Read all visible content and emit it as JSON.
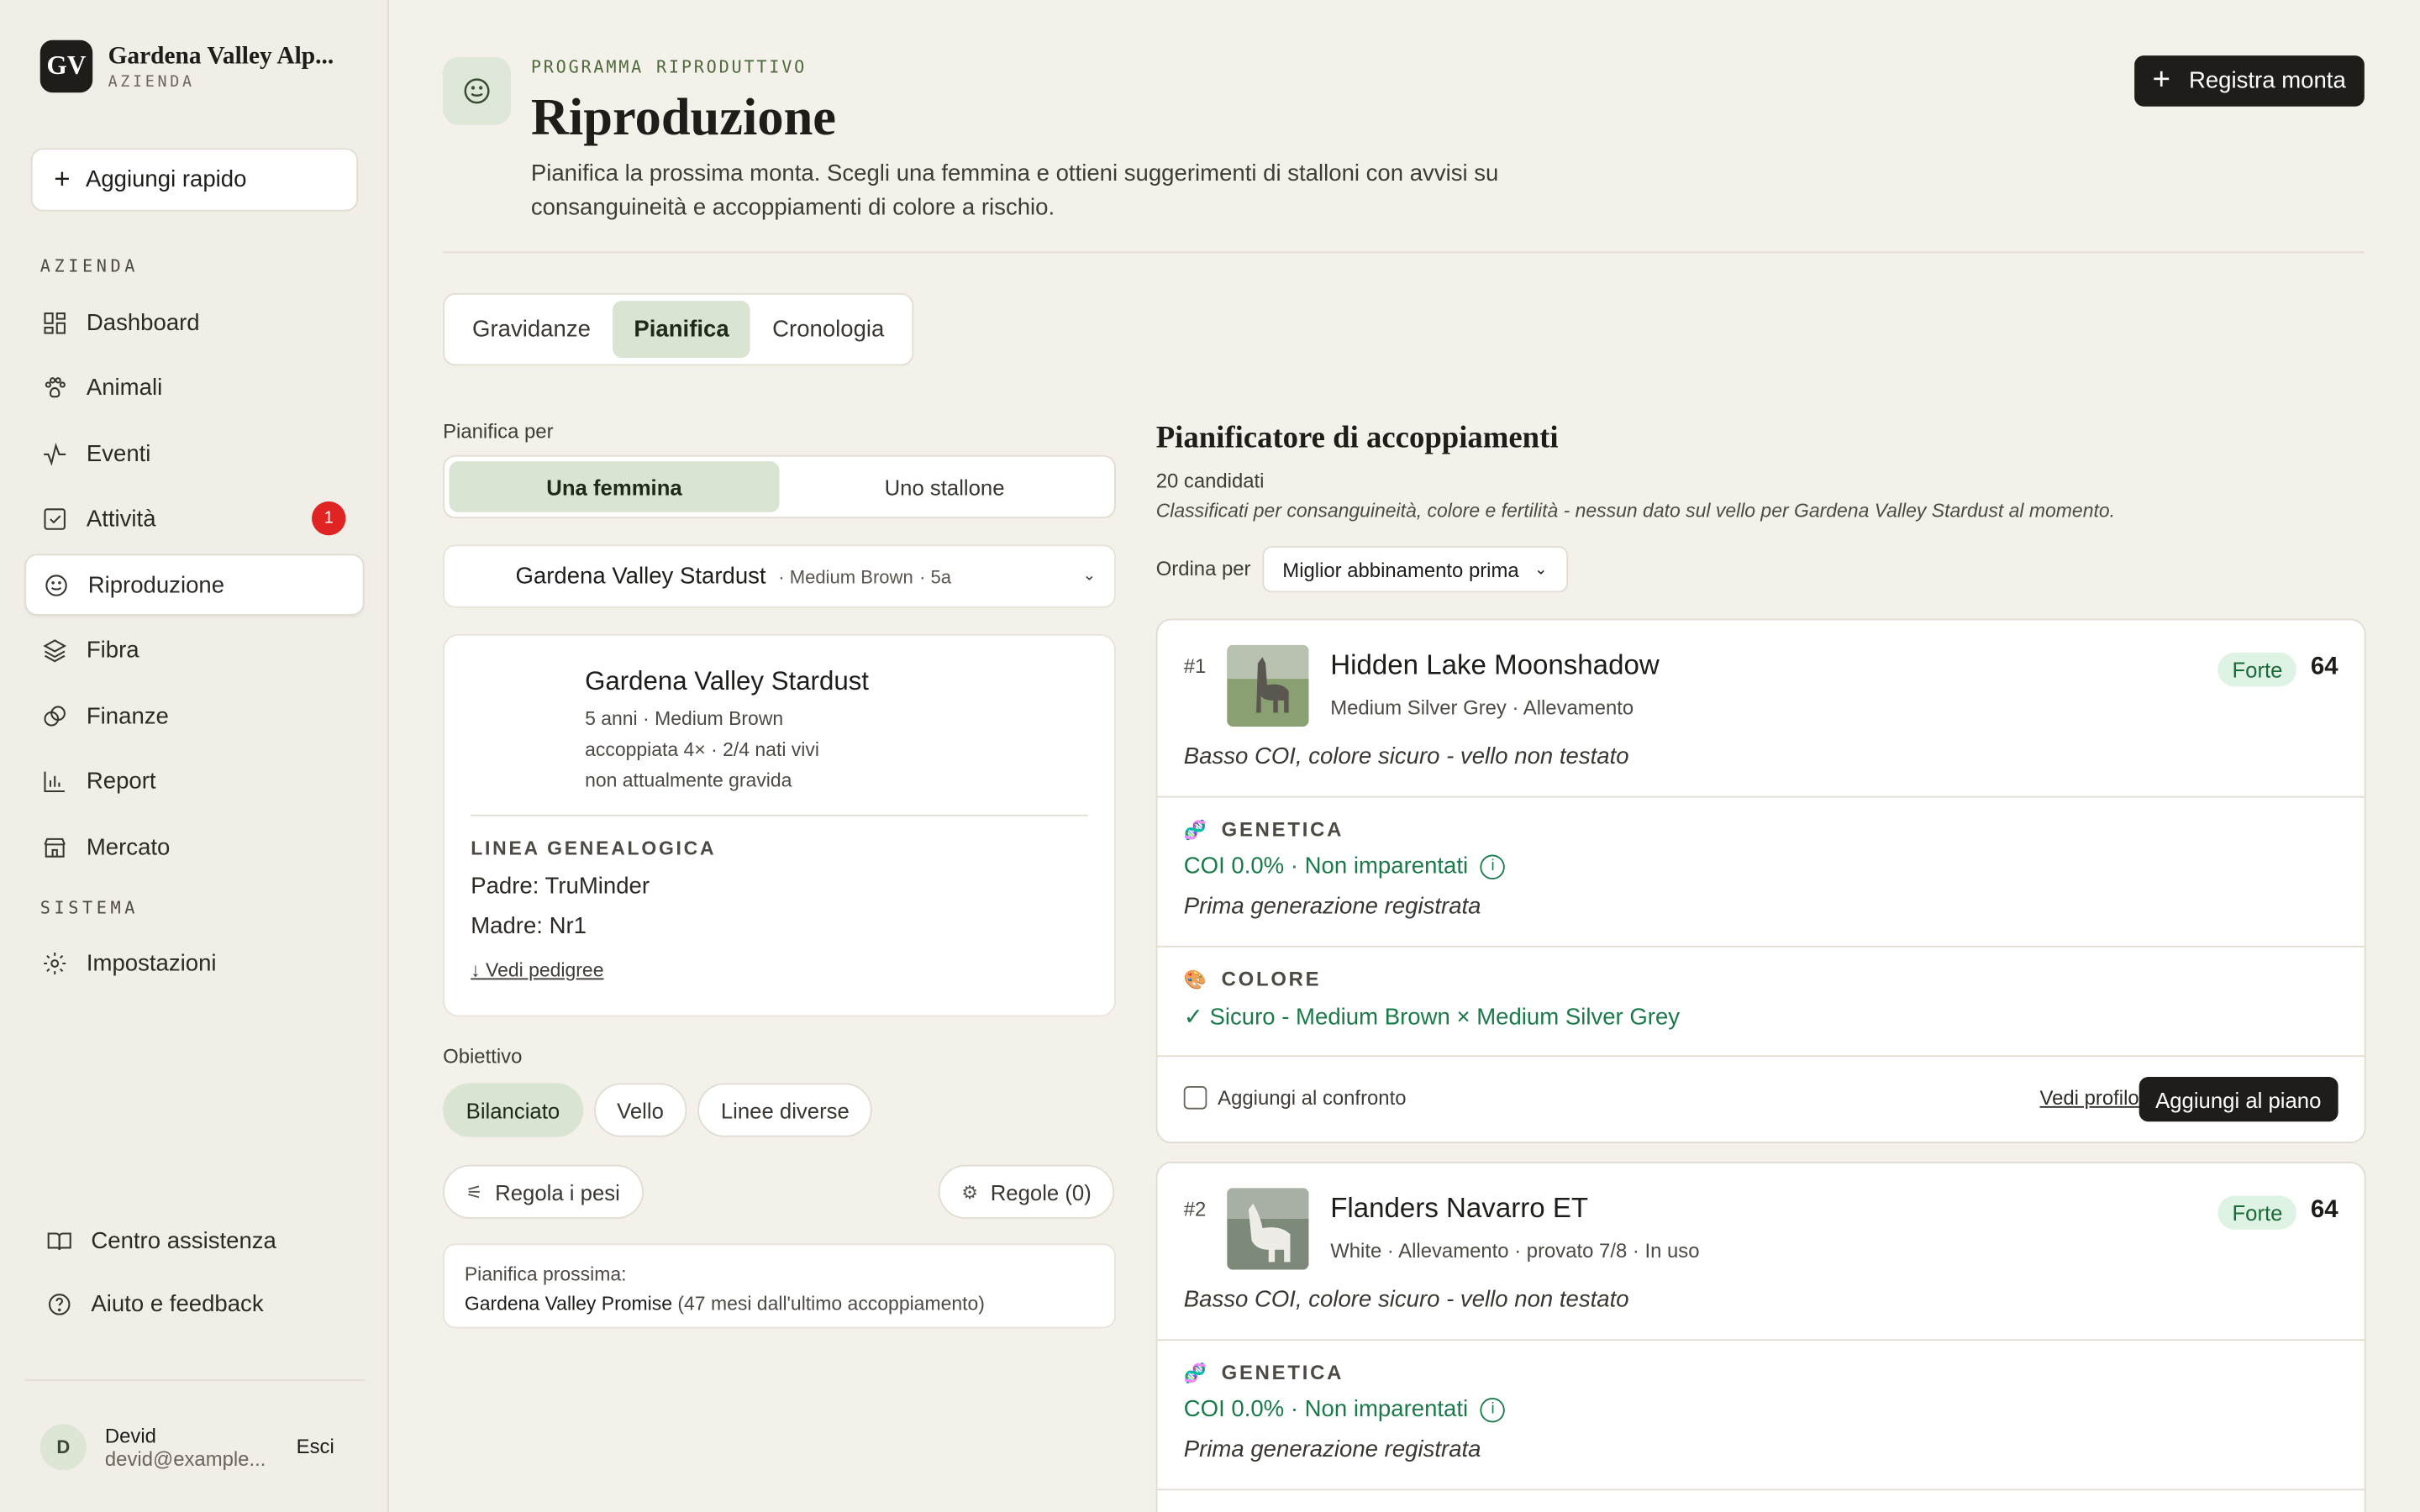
{
  "app": {
    "brand_initials": "GV",
    "brand_name": "Gardena Valley Alp...",
    "brand_sub": "AZIENDA",
    "quick_add": "Aggiungi rapido"
  },
  "sidebar": {
    "section_farm": "AZIENDA",
    "section_system": "SISTEMA",
    "items": [
      {
        "label": "Dashboard",
        "icon": "dashboard-icon"
      },
      {
        "label": "Animali",
        "icon": "paw-icon"
      },
      {
        "label": "Eventi",
        "icon": "activity-icon"
      },
      {
        "label": "Attività",
        "icon": "checkbox-icon",
        "badge": "1"
      },
      {
        "label": "Riproduzione",
        "icon": "smile-icon",
        "active": true
      },
      {
        "label": "Fibra",
        "icon": "layers-icon"
      },
      {
        "label": "Finanze",
        "icon": "coins-icon"
      },
      {
        "label": "Report",
        "icon": "bar-chart-icon"
      },
      {
        "label": "Mercato",
        "icon": "store-icon"
      }
    ],
    "settings": "Impostazioni",
    "help_center": "Centro assistenza",
    "help_feedback": "Aiuto e feedback",
    "user": {
      "initial": "D",
      "name": "Devid",
      "email": "devid@example...",
      "logout": "Esci"
    }
  },
  "header": {
    "eyebrow": "PROGRAMMA RIPRODUTTIVO",
    "title": "Riproduzione",
    "description": "Pianifica la prossima monta. Scegli una femmina e ottieni suggerimenti di stalloni con avvisi su consanguineità e accoppiamenti di colore a rischio.",
    "primary_button": "Registra monta"
  },
  "tabs": [
    "Gravidanze",
    "Pianifica",
    "Cronologia"
  ],
  "active_tab": "Pianifica",
  "planner": {
    "plan_for_label": "Pianifica per",
    "segments": [
      "Una femmina",
      "Uno stallone"
    ],
    "active_segment": "Una femmina",
    "selected_animal": "Gardena Valley Stardust",
    "selected_color": "· Medium Brown",
    "selected_age": "· 5a",
    "profile": {
      "name": "Gardena Valley Stardust",
      "line1": "5 anni · Medium Brown",
      "line2": "accoppiata 4× · 2/4 nati vivi",
      "line3": "non attualmente gravida",
      "lineage_title": "LINEA GENEALOGICA",
      "sire": "Padre: TruMinder",
      "dam": "Madre: Nr1",
      "pedigree_link": "↓ Vedi pedigree"
    },
    "goal_label": "Obiettivo",
    "goals": [
      "Bilanciato",
      "Vello",
      "Linee diverse"
    ],
    "active_goal": "Bilanciato",
    "weights_button": "Regola i pesi",
    "rules_button": "Regole (0)",
    "next_label": "Pianifica prossima:",
    "next_animal": "Gardena Valley Promise",
    "next_detail": "(47 mesi dall'ultimo accoppiamento)"
  },
  "matcher": {
    "title": "Pianificatore di accoppiamenti",
    "count": "20 candidati",
    "note": "Classificati per consanguineità, colore e fertilità - nessun dato sul vello per Gardena Valley Stardust al momento.",
    "sort_label": "Ordina per",
    "sort_value": "Miglior abbinamento prima",
    "candidates": [
      {
        "rank": "#1",
        "name": "Hidden Lake Moonshadow",
        "meta": "Medium Silver Grey · Allevamento",
        "strength": "Forte",
        "score": "64",
        "summary": "Basso COI, colore sicuro - vello non testato",
        "genetics_title": "GENETICA",
        "genetics_value": "COI 0.0% · Non imparentati",
        "genetics_note": "Prima generazione registrata",
        "color_title": "COLORE",
        "color_value": "✓ Sicuro - Medium Brown × Medium Silver Grey",
        "compare": "Aggiungi al confronto",
        "profile_link": "Vedi profilo",
        "plan_button": "Aggiungi al piano"
      },
      {
        "rank": "#2",
        "name": "Flanders Navarro ET",
        "meta": "White · Allevamento · provato 7/8 · In uso",
        "strength": "Forte",
        "score": "64",
        "summary": "Basso COI, colore sicuro - vello non testato",
        "genetics_title": "GENETICA",
        "genetics_value": "COI 0.0% · Non imparentati",
        "genetics_note": "Prima generazione registrata"
      }
    ]
  },
  "colors": {
    "accent_green": "#d9e4d3",
    "ok_green": "#1b7a4a",
    "dark": "#1f1d1a",
    "badge_red": "#e02424"
  }
}
